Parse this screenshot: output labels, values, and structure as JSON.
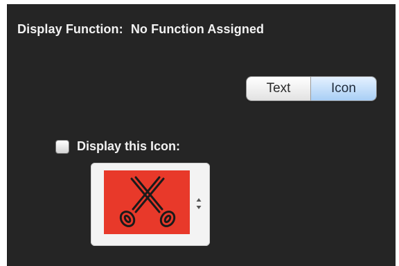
{
  "display_function": {
    "label": "Display Function:",
    "value": "No Function Assigned"
  },
  "mode_toggle": {
    "options": [
      "Text",
      "Icon"
    ],
    "selected": "Icon"
  },
  "display_icon": {
    "checkbox_label": "Display this Icon:",
    "checked": false,
    "icon_name": "scissors-icon",
    "icon_background": "#e8392a"
  },
  "colors": {
    "panel_background": "#252525",
    "text": "#f2f2f2",
    "selected_segment": "#a9cff5"
  }
}
